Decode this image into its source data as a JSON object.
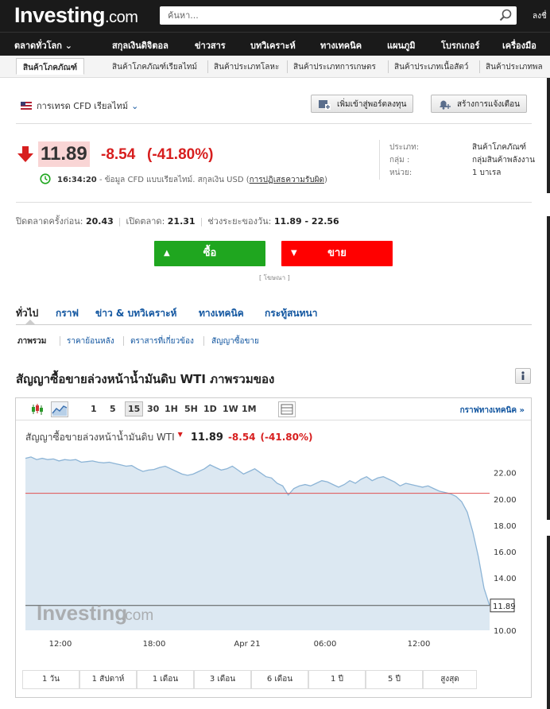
{
  "header": {
    "logo_main": "Investing",
    "logo_suffix": ".com",
    "search_placeholder": "ค้นหา...",
    "login_label": "ลงชื่"
  },
  "nav": [
    {
      "label": "ตลาดทั่วโลก ⌄"
    },
    {
      "label": "สกุลเงินดิจิตอล"
    },
    {
      "label": "ข่าวสาร"
    },
    {
      "label": "บทวิเคราะห์"
    },
    {
      "label": "ทางเทคนิค"
    },
    {
      "label": "แผนภูมิ"
    },
    {
      "label": "โบรกเกอร์"
    },
    {
      "label": "เครื่องมือ"
    }
  ],
  "subnav": [
    {
      "label": "สินค้าโภคภัณฑ์"
    },
    {
      "label": "สินค้าโภคภัณฑ์เรียลไทม์"
    },
    {
      "label": "สินค้าประเภทโลหะ"
    },
    {
      "label": "สินค้าประเภทการเกษตร"
    },
    {
      "label": "สินค้าประเภทเนื้อสัตว์"
    },
    {
      "label": "สินค้าประเภทพล"
    }
  ],
  "instrument": {
    "market_label": "การเทรด CFD เรียลไทม์",
    "add_portfolio_label": "เพิ่มเข้าสู่พอร์ตลงทุน",
    "create_alert_label": "สร้างการแจ้งเตือน",
    "last_price": "11.89",
    "change": "-8.54",
    "change_pct": "(-41.80%)",
    "time": "16:34:20",
    "time_note": "- ข้อมูล CFD แบบเรียลไทม์. สกุลเงิน USD (",
    "disclaimer_link": "การปฏิเสธความรับผิด",
    "time_note_end": ")",
    "info": [
      {
        "key": "ประเภท:",
        "value": "สินค้าโภคภัณฑ์"
      },
      {
        "key": "กลุ่ม :",
        "value": "กลุ่มสินค้าพลังงาน"
      },
      {
        "key": "หน่วย:",
        "value": "1 บาเรล"
      }
    ],
    "stats": {
      "prev_close_label": "ปิดตลาดครั้งก่อน:",
      "prev_close": "20.43",
      "open_label": "เปิดตลาด:",
      "open": "21.31",
      "day_range_label": "ช่วงระยะของวัน:",
      "day_range": "11.89 - 22.56"
    },
    "buy_label": "ซื้อ",
    "sell_label": "ขาย",
    "ad_label": "[ โฆษณา ]"
  },
  "tabs": [
    {
      "label": "ทั่วไป"
    },
    {
      "label": "กราฟ"
    },
    {
      "label": "ข่าว & บทวิเคราะห์"
    },
    {
      "label": "ทางเทคนิค"
    },
    {
      "label": "กระทู้สนทนา"
    }
  ],
  "subtabs": [
    {
      "label": "ภาพรวม"
    },
    {
      "label": "ราคาย้อนหลัง"
    },
    {
      "label": "ตราสารที่เกี่ยวข้อง"
    },
    {
      "label": "สัญญาซื้อขาย"
    }
  ],
  "section_title": "สัญญาซื้อขายล่วงหน้าน้ำมันดิบ WTI ภาพรวมของ",
  "chart_toolbar": {
    "intervals": [
      "1",
      "5",
      "15",
      "30",
      "1H",
      "5H",
      "1D",
      "1W",
      "1M"
    ],
    "selected_interval": "15",
    "tech_chart_link": "กราฟทางเทคนิค »"
  },
  "chart_header": {
    "name": "สัญญาซื้อขายล่วงหน้าน้ำมันดิบ WTI",
    "price": "11.89",
    "change": "-8.54",
    "change_pct": "(-41.80%)"
  },
  "watermark": {
    "main": "Investing",
    "suffix": ".com"
  },
  "ranges": [
    "1 วัน",
    "1 สัปดาห์",
    "1 เดือน",
    "3 เดือน",
    "6 เดือน",
    "1 ปี",
    "5 ปี",
    "สูงสุด"
  ],
  "colors": {
    "brand_bg": "#1a1a1a",
    "link_blue": "#1256a0",
    "down_red": "#d71e1e",
    "buy_green": "#1fa61f",
    "sell_red": "#ff0000",
    "area_fill": "#dce8f2",
    "line_blue": "#8cb4d6",
    "prev_close_line": "#e05050"
  },
  "chart_data": {
    "type": "area",
    "x_tick_labels": [
      "12:00",
      "18:00",
      "Apr 21",
      "06:00",
      "12:00"
    ],
    "y_tick_labels": [
      "22.00",
      "20.00",
      "18.00",
      "16.00",
      "14.00",
      "10.00"
    ],
    "ylim": [
      10,
      23.8
    ],
    "last_label": "11.89",
    "reference_line": {
      "value": 20.43
    },
    "current_line": {
      "value": 11.89
    },
    "series": [
      {
        "values": [
          23.1,
          23.2,
          23.0,
          23.1,
          23.0,
          23.05,
          22.9,
          23.0,
          22.95,
          23.0,
          22.8,
          22.85,
          22.9,
          22.8,
          22.75,
          22.8,
          22.7,
          22.6,
          22.5,
          22.55,
          22.3,
          22.1,
          22.2,
          22.25,
          22.4,
          22.5,
          22.3,
          22.1,
          21.9,
          21.8,
          21.9,
          22.1,
          22.3,
          22.6,
          22.4,
          22.2,
          22.3,
          22.5,
          22.2,
          21.9,
          22.1,
          22.3,
          22.0,
          21.7,
          21.6,
          21.2,
          21.0,
          20.3,
          20.8,
          21.0,
          21.1,
          21.0,
          21.2,
          21.4,
          21.3,
          21.1,
          20.9,
          21.1,
          21.4,
          21.2,
          21.5,
          21.7,
          21.4,
          21.6,
          21.7,
          21.5,
          21.3,
          21.0,
          21.2,
          21.1,
          21.0,
          20.9,
          21.0,
          20.8,
          20.6,
          20.5,
          20.4,
          20.2,
          19.8,
          19.0,
          17.5,
          15.6,
          13.2,
          11.89
        ]
      }
    ]
  }
}
